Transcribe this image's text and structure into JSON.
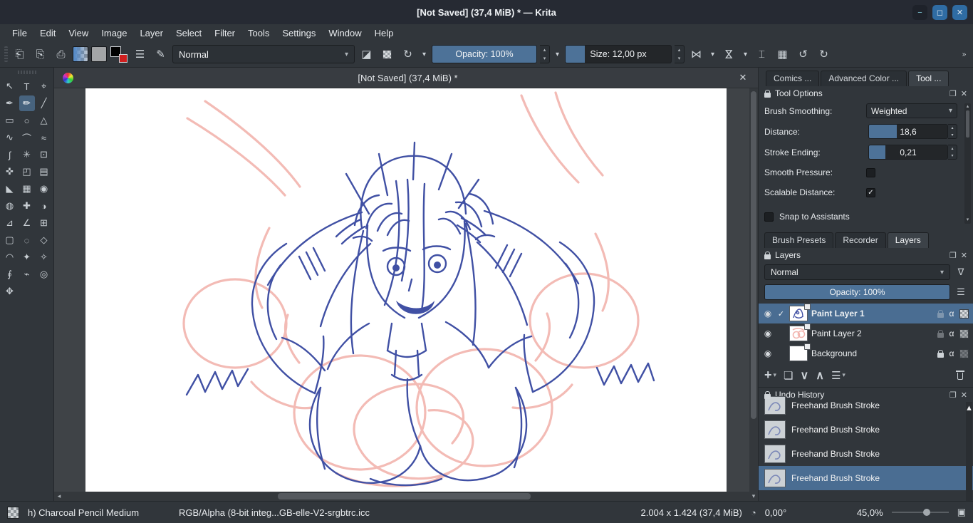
{
  "window": {
    "title": "[Not Saved]  (37,4 MiB) * — Krita"
  },
  "menu": {
    "items": [
      "File",
      "Edit",
      "View",
      "Image",
      "Layer",
      "Select",
      "Filter",
      "Tools",
      "Settings",
      "Window",
      "Help"
    ]
  },
  "toolbar": {
    "blending_mode": "Normal",
    "opacity_label": "Opacity: 100%",
    "size_label": "Size: 12,00 px"
  },
  "canvas": {
    "tab_title": "[Not Saved]  (37,4 MiB) *"
  },
  "toolbox": {
    "tools": [
      {
        "name": "select-shapes",
        "glyph": "↖"
      },
      {
        "name": "text",
        "glyph": "T"
      },
      {
        "name": "edit-shapes",
        "glyph": "⌖"
      },
      {
        "name": "calligraphy",
        "glyph": "✒"
      },
      {
        "name": "freehand-brush",
        "glyph": "✏"
      },
      {
        "name": "line",
        "glyph": "╱"
      },
      {
        "name": "rectangle",
        "glyph": "▭"
      },
      {
        "name": "ellipse",
        "glyph": "○"
      },
      {
        "name": "polygon",
        "glyph": "△"
      },
      {
        "name": "polyline",
        "glyph": "∿"
      },
      {
        "name": "bezier-curve",
        "glyph": "⌒"
      },
      {
        "name": "freehand-path",
        "glyph": "≈"
      },
      {
        "name": "dynamic-brush",
        "glyph": "∫"
      },
      {
        "name": "multibrush",
        "glyph": "✳"
      },
      {
        "name": "transform",
        "glyph": "⊡"
      },
      {
        "name": "move",
        "glyph": "✜"
      },
      {
        "name": "crop",
        "glyph": "◰"
      },
      {
        "name": "gradient",
        "glyph": "▤"
      },
      {
        "name": "color-sampler",
        "glyph": "◣"
      },
      {
        "name": "pattern-edit",
        "glyph": "▦"
      },
      {
        "name": "fill",
        "glyph": "◉"
      },
      {
        "name": "enclose-fill",
        "glyph": "◍"
      },
      {
        "name": "smart-patch",
        "glyph": "✚"
      },
      {
        "name": "colorize-mask",
        "glyph": "◑"
      },
      {
        "name": "assistants",
        "glyph": "⊿"
      },
      {
        "name": "measure",
        "glyph": "∠"
      },
      {
        "name": "reference-images",
        "glyph": "⊞"
      },
      {
        "name": "rect-select",
        "glyph": "▢"
      },
      {
        "name": "ellipse-select",
        "glyph": "◌"
      },
      {
        "name": "polygon-select",
        "glyph": "◇"
      },
      {
        "name": "freehand-select",
        "glyph": "◠"
      },
      {
        "name": "contiguous-select",
        "glyph": "✦"
      },
      {
        "name": "similar-select",
        "glyph": "✧"
      },
      {
        "name": "bezier-select",
        "glyph": "∮"
      },
      {
        "name": "magnetic-select",
        "glyph": "⌁"
      },
      {
        "name": "zoom",
        "glyph": "◎"
      },
      {
        "name": "pan",
        "glyph": "✥"
      }
    ]
  },
  "dockers": {
    "top_tabs": [
      {
        "label": "Comics ..."
      },
      {
        "label": "Advanced Color ..."
      },
      {
        "label": "Tool ..."
      }
    ],
    "tool_options": {
      "title": "Tool Options",
      "rows": [
        {
          "label": "Brush Smoothing:",
          "value": "Weighted"
        },
        {
          "label": "Distance:",
          "value": "18,6"
        },
        {
          "label": "Stroke Ending:",
          "value": "0,21"
        },
        {
          "label": "Smooth Pressure:"
        },
        {
          "label": "Scalable Distance:"
        }
      ],
      "snap_label": "Snap to Assistants"
    },
    "panel_tabs": [
      {
        "label": "Brush Presets"
      },
      {
        "label": "Recorder"
      },
      {
        "label": "Layers"
      }
    ],
    "layers": {
      "title": "Layers",
      "blending_mode": "Normal",
      "opacity_label": "Opacity:  100%",
      "rows": [
        {
          "name": "Paint Layer 1"
        },
        {
          "name": "Paint Layer 2"
        },
        {
          "name": "Background"
        }
      ]
    },
    "undo_history": {
      "title": "Undo History",
      "items": [
        "Freehand Brush Stroke",
        "Freehand Brush Stroke",
        "Freehand Brush Stroke",
        "Freehand Brush Stroke"
      ]
    }
  },
  "statusbar": {
    "brush_name": "h) Charcoal Pencil Medium",
    "color_profile": "RGB/Alpha (8-bit integ...GB-elle-V2-srgbtrc.icc",
    "canvas_size": "2.004 x 1.424 (37,4 MiB)",
    "angle": "0,00°",
    "zoom": "45,0%"
  },
  "colors": {
    "accent": "#4d7298",
    "selection": "#4a6d92",
    "sketch_blue": "#4050a4",
    "sketch_pink": "#f2b4ae"
  },
  "icons": {
    "minimize": "−",
    "maximize": "◻",
    "close": "✕",
    "new_doc": "⎗",
    "open_doc": "⎘",
    "save_doc": "⎙",
    "brush_settings": "☰",
    "brush_preset": "✎",
    "eraser": "◪",
    "reload": "↻",
    "caret_down": "▾",
    "caret_up": "▴",
    "mirror": "⋈",
    "snap": "⌶",
    "grid_view": "▦",
    "undo": "↺",
    "redo": "↻",
    "overflow": "»",
    "float": "❐",
    "close_small": "✕",
    "eye": "◉",
    "check": "✓",
    "alpha": "α",
    "filter_funnel": "∇",
    "hamburger": "☰",
    "add": "+",
    "duplicate": "❏",
    "arrow_down": "∨",
    "arrow_up": "∧",
    "scroll_up": "▴",
    "scroll_down": "▾",
    "scroll_left": "◂",
    "scroll_right": "▸",
    "angle_dial": "◔",
    "canvas_only": "▣"
  }
}
